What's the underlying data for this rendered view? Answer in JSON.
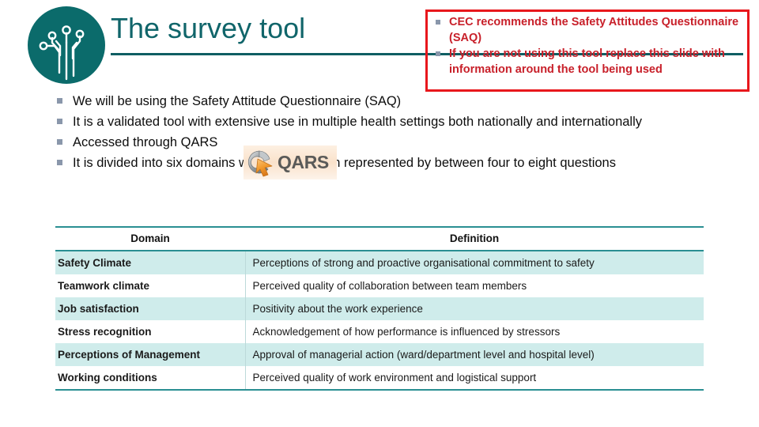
{
  "slide": {
    "title": "The survey tool",
    "logo_icon": "circuit-plant-logo",
    "accent_teal": "#10656a",
    "accent_red": "#e8171c",
    "table_accent": "#2a8f92",
    "row_alt_color": "#cfeceb"
  },
  "callout": {
    "items": [
      "CEC recommends the Safety Attitudes Questionnaire (SAQ)",
      "If you are not using this tool replace this slide with information around the tool being used"
    ]
  },
  "body": {
    "bullets": [
      "We will be using the Safety Attitude Questionnaire (SAQ)",
      "It is a validated tool with extensive use in multiple health settings both nationally and internationally",
      "Accessed through QARS",
      "It is divided into six domains with each domain represented by between four to eight questions"
    ]
  },
  "qars_logo": {
    "word": "QARS",
    "icon": "qars-cursor-icon"
  },
  "table": {
    "headers": [
      "Domain",
      "Definition"
    ],
    "rows": [
      {
        "domain": "Safety Climate",
        "definition": "Perceptions of strong and proactive organisational commitment to safety"
      },
      {
        "domain": "Teamwork climate",
        "definition": "Perceived quality of collaboration between team members"
      },
      {
        "domain": "Job satisfaction",
        "definition": "Positivity about the work experience"
      },
      {
        "domain": "Stress recognition",
        "definition": "Acknowledgement of how performance is influenced by stressors"
      },
      {
        "domain": "Perceptions of Management",
        "definition": "Approval of managerial action (ward/department level and hospital level)"
      },
      {
        "domain": "Working conditions",
        "definition": "Perceived quality of work environment and logistical support"
      }
    ]
  }
}
